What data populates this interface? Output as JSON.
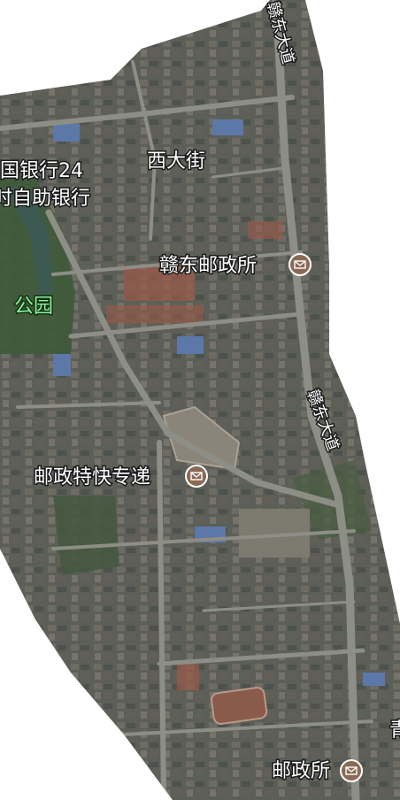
{
  "map": {
    "type": "satellite",
    "colors": {
      "background": "#ffffff",
      "satellite_base": "#5a5d55",
      "road": "#8d8e86",
      "vegetation": "#3f5a3a",
      "water": "#3c5a52",
      "roof_blue": "#5b78a8",
      "roof_red": "#9a5a48",
      "label_fill": "#ffffff",
      "label_halo": "#1a1a1a",
      "park_label": "#8ff0a0",
      "poi_marker": "#8a6a55"
    }
  },
  "labels": {
    "road_top": "赣东大道",
    "road_mid": "赣东大道",
    "street": "西大街",
    "bank_line1": "国银行24",
    "bank_line2": "时自助银行",
    "post_office": "赣东邮政所",
    "park": "公园",
    "express": "邮政特快专递",
    "bottom_post": "邮政所",
    "edge_char": "青"
  },
  "poi_icons": [
    "envelope-icon",
    "envelope-icon",
    "envelope-icon"
  ]
}
